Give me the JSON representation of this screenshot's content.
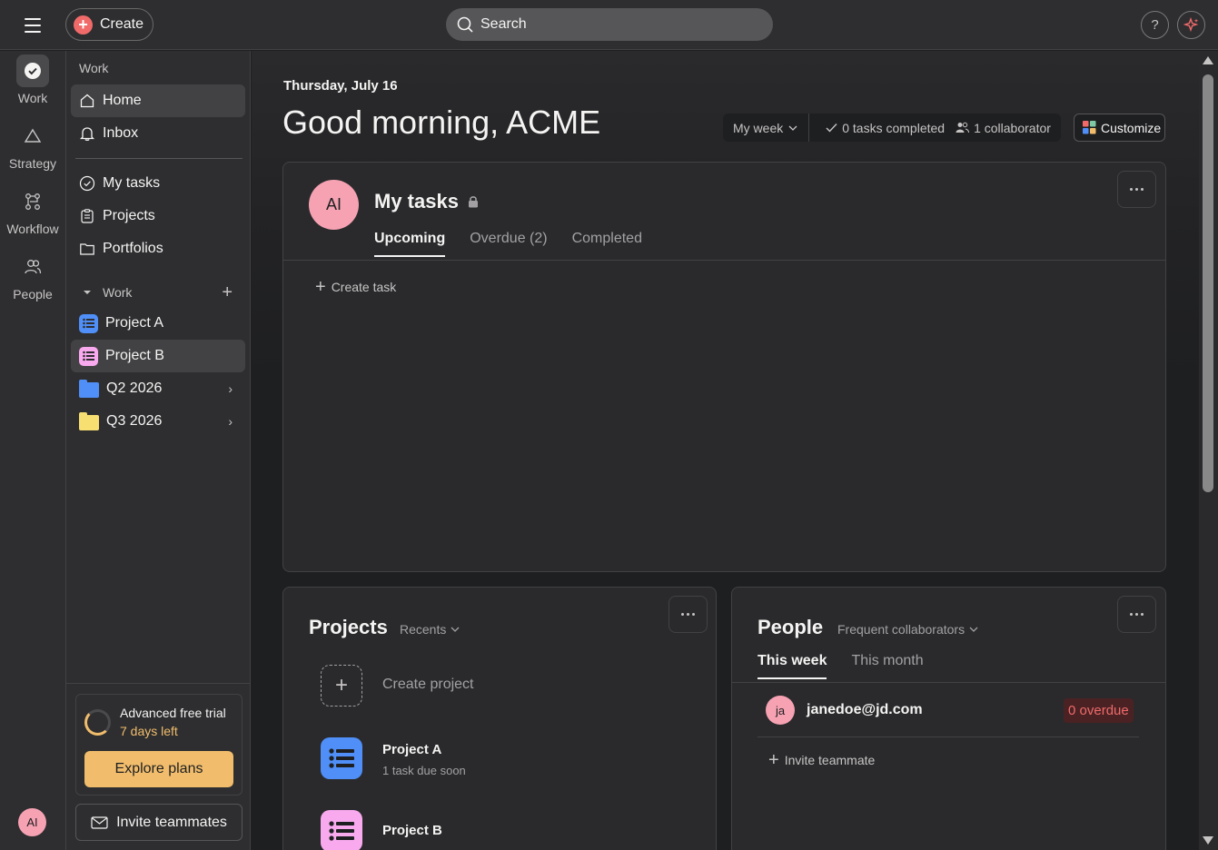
{
  "topbar": {
    "menu_icon": "hamburger-icon",
    "create_label": "Create",
    "search_placeholder": "Search",
    "help_label": "?",
    "ai_icon": "sparkle-icon"
  },
  "rail": {
    "items": [
      {
        "label": "Work",
        "icon": "check-circle-icon"
      },
      {
        "label": "Strategy",
        "icon": "triangle-icon"
      },
      {
        "label": "Workflow",
        "icon": "workflow-icon"
      },
      {
        "label": "People",
        "icon": "people-icon"
      }
    ],
    "avatar_initials": "AI"
  },
  "sidebar": {
    "section_label": "Work",
    "nav": [
      {
        "label": "Home",
        "icon": "home-icon"
      },
      {
        "label": "Inbox",
        "icon": "bell-icon"
      }
    ],
    "links": [
      {
        "label": "My tasks",
        "icon": "check-circle-icon"
      },
      {
        "label": "Projects",
        "icon": "clipboard-icon"
      },
      {
        "label": "Portfolios",
        "icon": "folder-icon"
      }
    ],
    "team_label": "Work",
    "projects": [
      {
        "label": "Project A",
        "color": "#4f8ff7"
      },
      {
        "label": "Project B",
        "color": "#f9aaef"
      }
    ],
    "folders": [
      {
        "label": "Q2 2026",
        "color": "#4f8ff7"
      },
      {
        "label": "Q3 2026",
        "color": "#f8df72"
      }
    ],
    "trial": {
      "title": "Advanced free trial",
      "days": "7 days left",
      "button": "Explore plans"
    },
    "invite_label": "Invite teammates"
  },
  "main": {
    "date": "Thursday, July 16",
    "greeting": "Good morning, ACME",
    "period": "My week",
    "tasks_completed": "0 tasks completed",
    "collaborators": "1 collaborator",
    "customize": "Customize"
  },
  "my_tasks": {
    "avatar_initials": "AI",
    "title": "My tasks",
    "tabs": [
      "Upcoming",
      "Overdue (2)",
      "Completed"
    ],
    "create_task": "Create task"
  },
  "projects_card": {
    "title": "Projects",
    "filter": "Recents",
    "create_project": "Create project",
    "items": [
      {
        "name": "Project A",
        "sub": "1 task due soon",
        "color": "#4f8ff7"
      },
      {
        "name": "Project B",
        "sub": "",
        "color": "#f9aaef"
      }
    ]
  },
  "people_card": {
    "title": "People",
    "filter": "Frequent collaborators",
    "tabs": [
      "This week",
      "This month"
    ],
    "person": {
      "initials": "ja",
      "email": "janedoe@jd.com",
      "overdue": "0 overdue"
    },
    "invite": "Invite teammate"
  },
  "colors": {
    "accent_red": "#f06a6a",
    "trial_yellow": "#f1bd6c",
    "avatar_pink": "#f6a2b3"
  }
}
